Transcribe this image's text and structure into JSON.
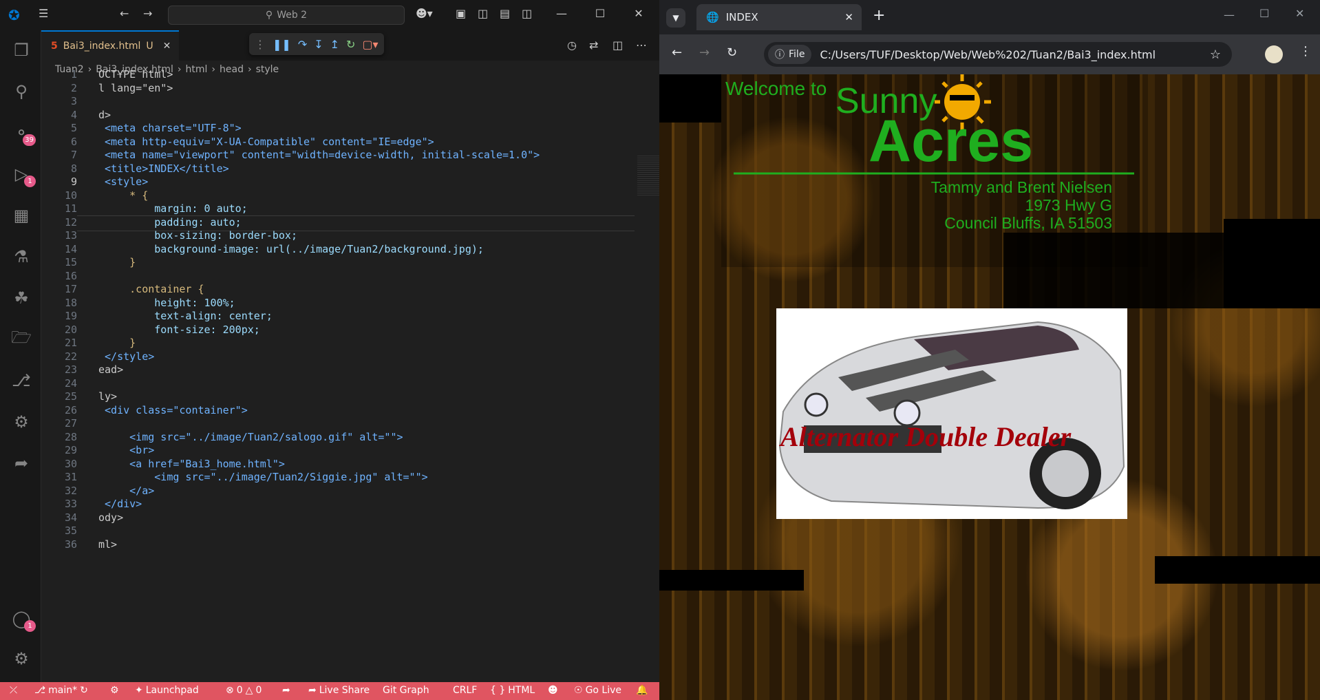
{
  "vscode": {
    "command_center": "Web 2",
    "tab": {
      "filename": "Bai3_index.html",
      "status": "U"
    },
    "breadcrumb": [
      "Tuan2",
      "Bai3_index.html",
      "html",
      "head",
      "style"
    ],
    "badges": {
      "source_control": "39",
      "run_debug": "1",
      "accounts": "1"
    },
    "lines": [
      {
        "n": "1",
        "text": "OCTYPE html>"
      },
      {
        "n": "2",
        "text": "l lang=\"en\">"
      },
      {
        "n": "3",
        "text": ""
      },
      {
        "n": "4",
        "text": "d>"
      },
      {
        "n": "5",
        "text": " <meta charset=\"UTF-8\">"
      },
      {
        "n": "6",
        "text": " <meta http-equiv=\"X-UA-Compatible\" content=\"IE=edge\">"
      },
      {
        "n": "7",
        "text": " <meta name=\"viewport\" content=\"width=device-width, initial-scale=1.0\">"
      },
      {
        "n": "8",
        "text": " <title>INDEX</title>"
      },
      {
        "n": "9",
        "text": " <style>"
      },
      {
        "n": "10",
        "text": "     * {"
      },
      {
        "n": "11",
        "text": "         margin: 0 auto;"
      },
      {
        "n": "12",
        "text": "         padding: auto;"
      },
      {
        "n": "13",
        "text": "         box-sizing: border-box;"
      },
      {
        "n": "14",
        "text": "         background-image: url(../image/Tuan2/background.jpg);"
      },
      {
        "n": "15",
        "text": "     }"
      },
      {
        "n": "16",
        "text": ""
      },
      {
        "n": "17",
        "text": "     .container {"
      },
      {
        "n": "18",
        "text": "         height: 100%;"
      },
      {
        "n": "19",
        "text": "         text-align: center;"
      },
      {
        "n": "20",
        "text": "         font-size: 200px;"
      },
      {
        "n": "21",
        "text": "     }"
      },
      {
        "n": "22",
        "text": " </style>"
      },
      {
        "n": "23",
        "text": "ead>"
      },
      {
        "n": "24",
        "text": ""
      },
      {
        "n": "25",
        "text": "ly>"
      },
      {
        "n": "26",
        "text": " <div class=\"container\">"
      },
      {
        "n": "27",
        "text": ""
      },
      {
        "n": "28",
        "text": "     <img src=\"../image/Tuan2/salogo.gif\" alt=\"\">"
      },
      {
        "n": "29",
        "text": "     <br>"
      },
      {
        "n": "30",
        "text": "     <a href=\"Bai3_home.html\">"
      },
      {
        "n": "31",
        "text": "         <img src=\"../image/Tuan2/Siggie.jpg\" alt=\"\">"
      },
      {
        "n": "32",
        "text": "     </a>"
      },
      {
        "n": "33",
        "text": " </div>"
      },
      {
        "n": "34",
        "text": "ody>"
      },
      {
        "n": "35",
        "text": ""
      },
      {
        "n": "36",
        "text": "ml>"
      }
    ],
    "status": {
      "branch": "main*",
      "launchpad": "Launchpad",
      "errors": "0",
      "warnings": "0",
      "live_share": "Live Share",
      "git_graph": "Git Graph",
      "eol": "CRLF",
      "language": "HTML",
      "go_live": "Go Live"
    }
  },
  "chrome": {
    "tab_title": "INDEX",
    "site_chip": "File",
    "url": "C:/Users/TUF/Desktop/Web/Web%202/Tuan2/Bai3_index.html"
  },
  "page": {
    "welcome": "Welcome to",
    "sunny": "Sunny",
    "acres": "Acres",
    "address": [
      "Tammy and Brent Nielsen",
      "1973 Hwy G",
      "Council Bluffs, IA  51503"
    ],
    "car_caption": "Alternator Double Dealer"
  },
  "colors": {
    "vscode_status": "#e05561",
    "logo_green": "#1fae1f",
    "caption_red": "#a4000a"
  }
}
